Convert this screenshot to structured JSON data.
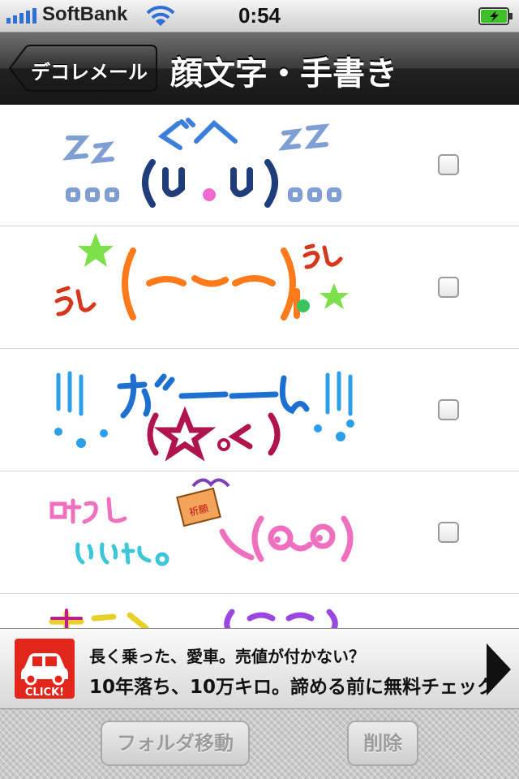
{
  "status_bar": {
    "carrier": "SoftBank",
    "time": "0:54"
  },
  "nav": {
    "back_label": "デコレメール",
    "title": "顔文字・手書き"
  },
  "ad": {
    "icon_text": "CLICK!",
    "line1": "長く乗った、愛車。売値が付かない？",
    "line2": "10年落ち、10万キロ。諦める前に無料チェック"
  },
  "toolbar": {
    "move_label": "フォルダ移動",
    "delete_label": "削除"
  },
  "colors": {
    "nav_dark": "#222222",
    "ad_red": "#e3261c"
  }
}
